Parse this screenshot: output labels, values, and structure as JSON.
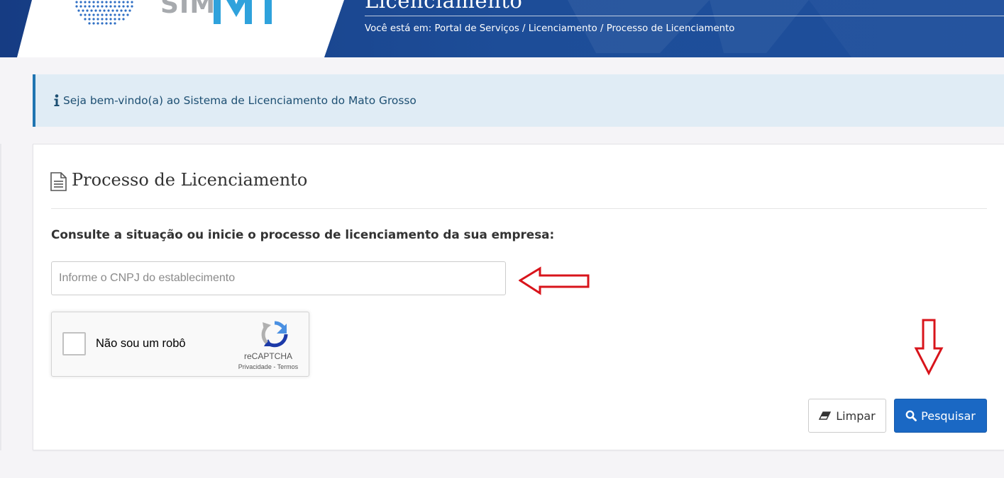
{
  "header": {
    "logo_text": "SIM",
    "logo_suffix": "MT",
    "title": "Licenciamento",
    "breadcrumb": "Você está em: Portal de Serviços / Licenciamento / Processo de Licenciamento"
  },
  "alert": {
    "icon": "info-icon",
    "text": "Seja bem-vindo(a) ao Sistema de Licenciamento do Mato Grosso"
  },
  "card": {
    "title_icon": "document-icon",
    "title": "Processo de Licenciamento",
    "subtitle": "Consulte a situação ou inicie o processo de licenciamento da sua empresa:",
    "cnpj_input": {
      "value": "",
      "placeholder": "Informe o CNPJ do establecimento"
    },
    "recaptcha": {
      "label": "Não sou um robô",
      "brand": "reCAPTCHA",
      "privacy": "Privacidade",
      "separator": " - ",
      "terms": "Termos"
    },
    "buttons": {
      "clear_label": "Limpar",
      "clear_icon": "eraser-icon",
      "search_label": "Pesquisar",
      "search_icon": "search-icon"
    }
  },
  "colors": {
    "header_blue": "#1a4690",
    "primary_button": "#1a68c4",
    "alert_background": "#e0ecf5",
    "alert_border": "#1f74b1",
    "annotation_red": "#d8141b",
    "logo_mt_blue": "#2fa2dc",
    "logo_gray": "#a7aaae"
  }
}
